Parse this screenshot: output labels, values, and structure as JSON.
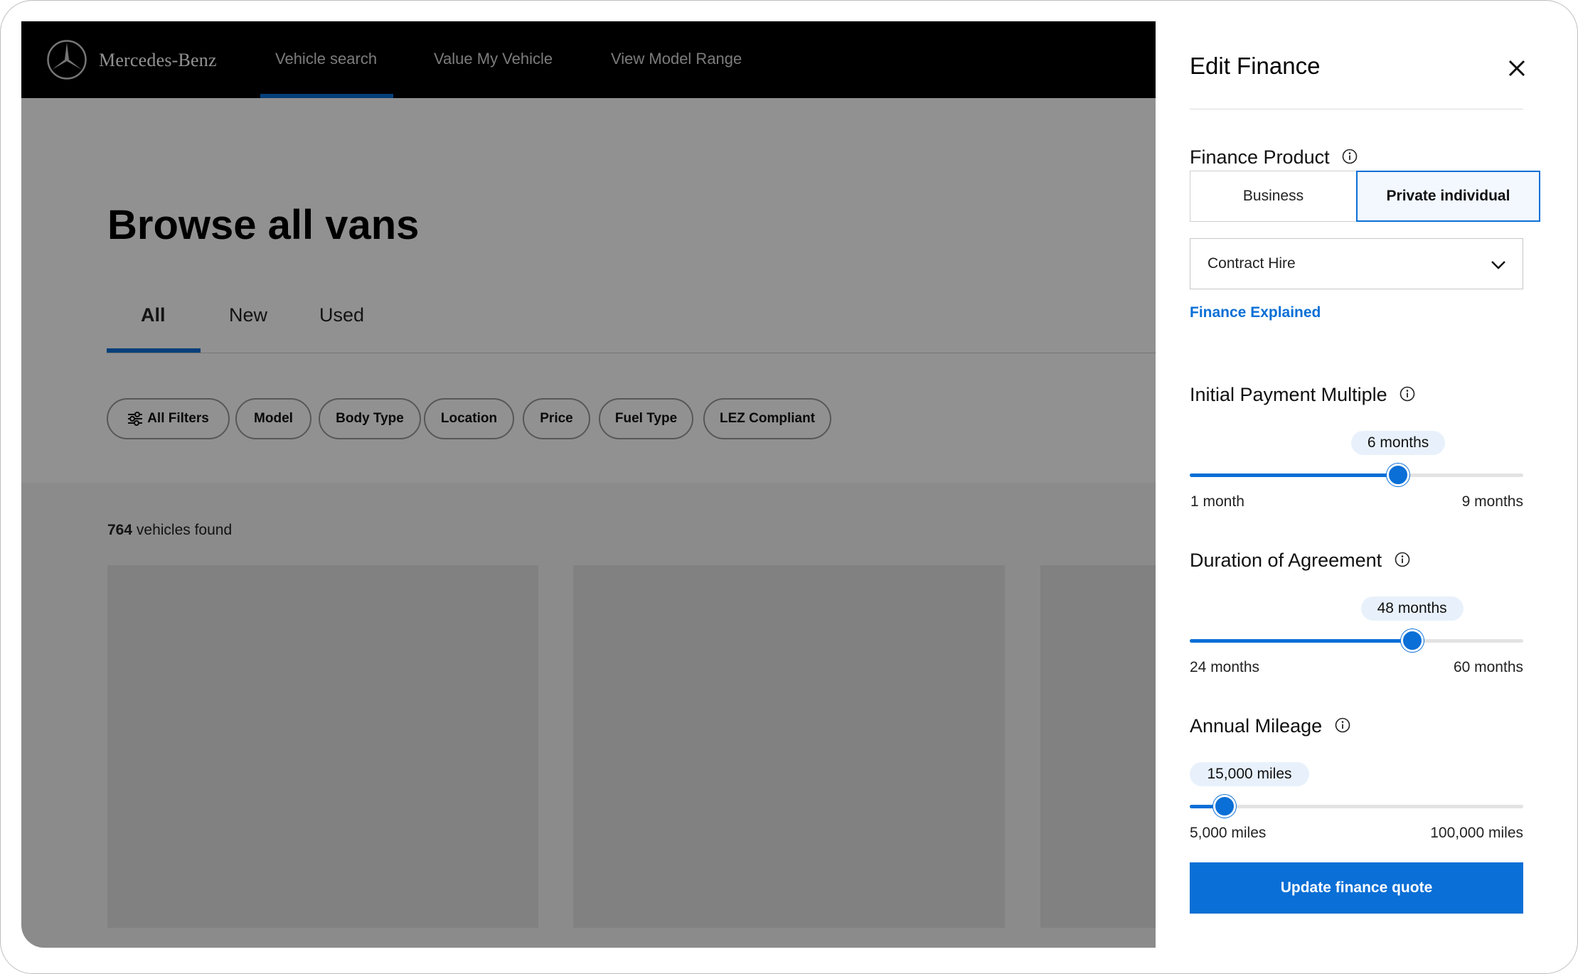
{
  "nav": {
    "brand": "Mercedes-Benz",
    "links": [
      "Vehicle search",
      "Value My Vehicle",
      "View Model Range"
    ],
    "active_link": "Vehicle search"
  },
  "page": {
    "title": "Browse all vans",
    "tabs": [
      "All",
      "New",
      "Used"
    ],
    "active_tab": "All",
    "filters": [
      "All Filters",
      "Model",
      "Body Type",
      "Location",
      "Price",
      "Fuel Type",
      "LEZ Compliant"
    ],
    "results": {
      "count": "764",
      "suffix": "vehicles found"
    }
  },
  "panel": {
    "title": "Edit Finance",
    "finance_product": {
      "title": "Finance Product",
      "options": [
        "Business",
        "Private individual"
      ],
      "selected": "Private individual",
      "product_select": "Contract Hire",
      "link": "Finance Explained"
    },
    "initial_payment": {
      "title": "Initial Payment Multiple",
      "value_label": "6 months",
      "value": 6,
      "min": 1,
      "max": 9,
      "min_label": "1 month",
      "max_label": "9 months"
    },
    "duration": {
      "title": "Duration of Agreement",
      "value_label": "48 months",
      "value": 48,
      "min": 24,
      "max": 60,
      "min_label": "24 months",
      "max_label": "60 months"
    },
    "mileage": {
      "title": "Annual Mileage",
      "value_label": "15,000 miles",
      "value": 15000,
      "min": 5000,
      "max": 100000,
      "min_label": "5,000 miles",
      "max_label": "100,000 miles"
    },
    "update_button": "Update finance quote"
  },
  "colors": {
    "accent": "#0a6fd6",
    "nav_bg": "#000000",
    "overlay": "rgba(0,0,0,0.43)"
  },
  "icons": [
    "mercedes-star-icon",
    "sliders-icon",
    "close-icon",
    "info-icon",
    "chevron-down-icon"
  ]
}
